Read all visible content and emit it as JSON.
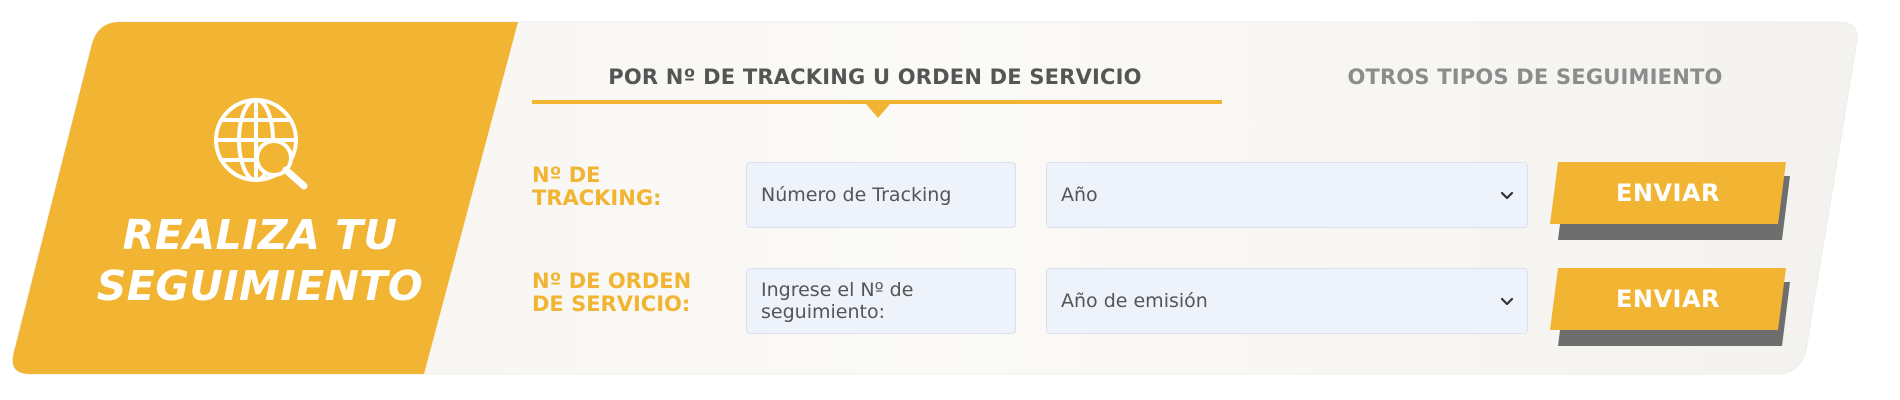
{
  "brand": {
    "title_line1": "REALIZA TU",
    "title_line2": "SEGUIMIENTO",
    "icon": "globe-search-icon"
  },
  "tabs": [
    {
      "label": "POR Nº DE TRACKING U ORDEN DE SERVICIO",
      "active": true
    },
    {
      "label": "OTROS TIPOS DE SEGUIMIENTO",
      "active": false
    }
  ],
  "rows": [
    {
      "label": "Nº DE TRACKING:",
      "input_placeholder": "Número de Tracking",
      "select_value": "Año",
      "button_label": "ENVIAR"
    },
    {
      "label": "Nº DE ORDEN DE SERVICIO:",
      "input_placeholder": "Ingrese el Nº de seguimiento:",
      "select_value": "Año de emisión",
      "button_label": "ENVIAR"
    }
  ],
  "colors": {
    "accent": "#f2b533",
    "button_shadow": "#6e6e6e",
    "field_bg": "#eef2fa"
  }
}
